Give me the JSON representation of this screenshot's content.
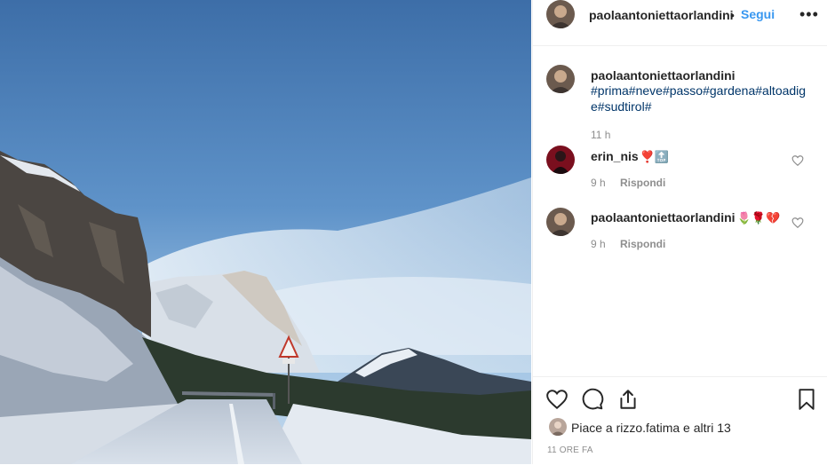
{
  "post": {
    "username": "paolaantoniettaorlandini",
    "separator": "•",
    "follow_label": "Segui",
    "more_label": "•••"
  },
  "caption": {
    "username": "paolaantoniettaorlandini",
    "text": "#prima#neve#passo#gardena#altoadige#sudtirol#",
    "time": "11 h"
  },
  "comments": [
    {
      "username": "erin_nis",
      "text": "❣️🔝",
      "time": "9 h",
      "reply_label": "Rispondi"
    },
    {
      "username": "paolaantoniettaorlandini",
      "text": "🌷🌹💔",
      "time": "9 h",
      "reply_label": "Rispondi"
    }
  ],
  "likes": {
    "prefix": "Piace a ",
    "user": "rizzo.fatima",
    "middle": " e ",
    "others": "altri 13"
  },
  "timestamp": "11 ORE FA",
  "icons": [
    "heart-icon",
    "comment-icon",
    "share-icon",
    "bookmark-icon",
    "more-icon"
  ],
  "colors": {
    "link": "#3897f0",
    "hashtag": "#003569",
    "muted": "#8e8e8e",
    "border": "#efefef"
  }
}
